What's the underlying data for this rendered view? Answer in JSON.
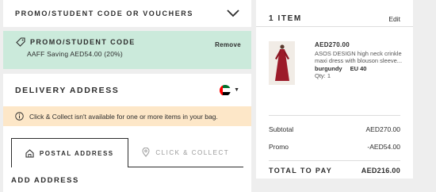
{
  "promo_section": {
    "header_label": "PROMO/STUDENT CODE OR VOUCHERS",
    "applied_title": "PROMO/STUDENT CODE",
    "applied_saving": "AAFF Saving AED54.00 (20%)",
    "remove_label": "Remove"
  },
  "delivery": {
    "title": "DELIVERY ADDRESS",
    "notice": "Click & Collect isn't available for one or more items in your bag.",
    "tabs": [
      {
        "label": "POSTAL ADDRESS",
        "active": true
      },
      {
        "label": "CLICK & COLLECT",
        "active": false
      }
    ],
    "add_address": "ADD ADDRESS"
  },
  "bag": {
    "count_label": "1 ITEM",
    "edit_label": "Edit",
    "item": {
      "price": "AED270.00",
      "name": "ASOS DESIGN high neck crinkle maxi dress with blouson sleeve...",
      "colour": "burgundy",
      "size": "EU 40",
      "qty": "Qty: 1"
    },
    "subtotal_label": "Subtotal",
    "subtotal_value": "AED270.00",
    "promo_label": "Promo",
    "promo_value": "-AED54.00",
    "total_label": "TOTAL TO PAY",
    "total_value": "AED216.00"
  },
  "icons": {
    "chevron": "chevron-down-icon",
    "tag": "tag-icon",
    "info": "info-icon",
    "home": "home-icon",
    "pin": "location-pin-icon",
    "flag": "uae-flag-icon"
  }
}
